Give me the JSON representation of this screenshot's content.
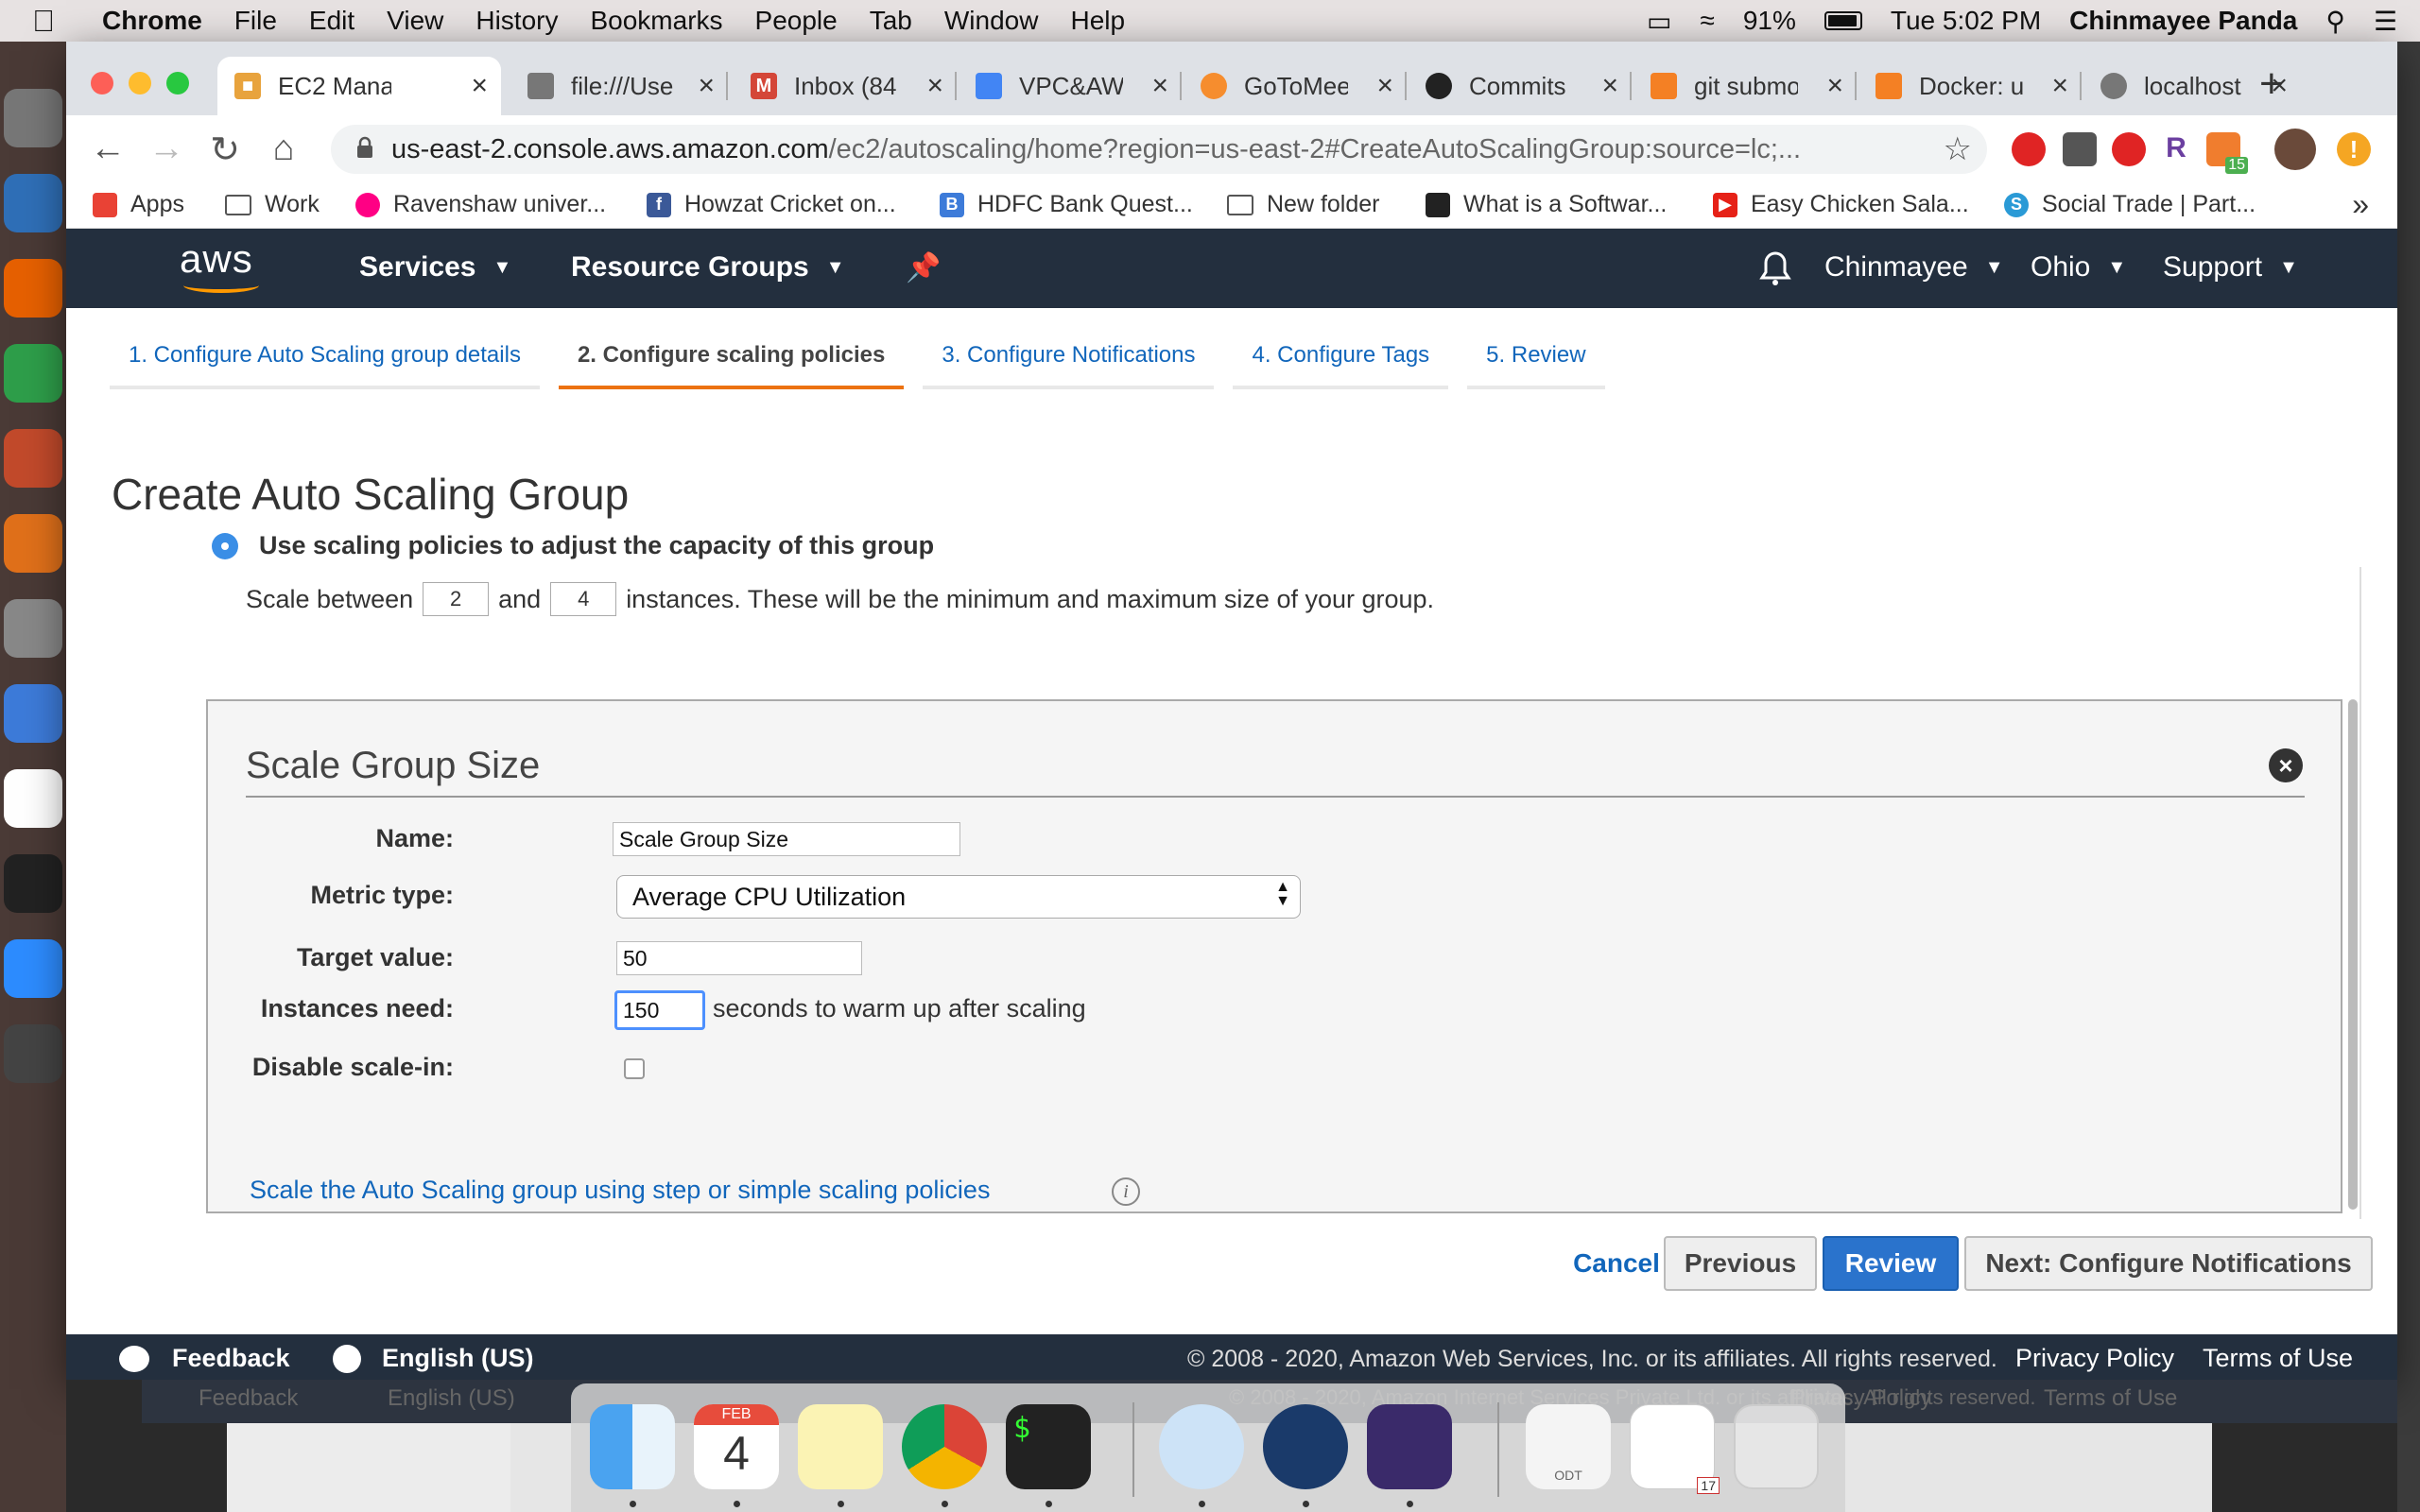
{
  "menubar": {
    "app": "Chrome",
    "items": [
      "File",
      "Edit",
      "View",
      "History",
      "Bookmarks",
      "People",
      "Tab",
      "Window",
      "Help"
    ],
    "battery": "91%",
    "clock": "Tue 5:02 PM",
    "user": "Chinmayee Panda"
  },
  "tabs": [
    {
      "title": "EC2 Mana",
      "icon": "aws-icon",
      "color": "#e8a33d"
    },
    {
      "title": "file:///Use",
      "icon": "globe-icon",
      "color": "#777777"
    },
    {
      "title": "Inbox (84",
      "icon": "gmail-icon",
      "color": "#d44638"
    },
    {
      "title": "VPC&AWS",
      "icon": "docs-icon",
      "color": "#4285f4"
    },
    {
      "title": "GoToMeet",
      "icon": "gotomeeting-icon",
      "color": "#f68d2e"
    },
    {
      "title": "Commits",
      "icon": "github-icon",
      "color": "#222222"
    },
    {
      "title": "git submo",
      "icon": "stackoverflow-icon",
      "color": "#f48024"
    },
    {
      "title": "Docker: u",
      "icon": "stackoverflow-icon",
      "color": "#f48024"
    },
    {
      "title": "localhost",
      "icon": "globe-icon",
      "color": "#777777"
    }
  ],
  "url": {
    "host": "us-east-2.console.aws.amazon.com",
    "path": "/ec2/autoscaling/home?region=us-east-2#CreateAutoScalingGroup:source=lc;..."
  },
  "bookmarks": [
    {
      "label": "Apps",
      "icon": "apps-grid-icon",
      "color": "#e94235"
    },
    {
      "label": "Work",
      "icon": "folder-icon",
      "color": ""
    },
    {
      "label": "Ravenshaw univer...",
      "icon": "flickr-icon",
      "color": "#ff0084"
    },
    {
      "label": "Howzat Cricket on...",
      "icon": "facebook-icon",
      "color": "#3b5998"
    },
    {
      "label": "HDFC Bank Quest...",
      "icon": "b-icon",
      "color": "#3d7bd9"
    },
    {
      "label": "New folder",
      "icon": "folder-icon",
      "color": ""
    },
    {
      "label": "What is a Softwar...",
      "icon": "site-icon",
      "color": "#222222"
    },
    {
      "label": "Easy Chicken Sala...",
      "icon": "youtube-icon",
      "color": "#e62117"
    },
    {
      "label": "Social Trade | Part...",
      "icon": "s-icon",
      "color": "#2a9ad6"
    }
  ],
  "aws": {
    "logo": "aws",
    "services": "Services",
    "resource_groups": "Resource Groups",
    "account": "Chinmayee",
    "region": "Ohio",
    "support": "Support"
  },
  "steps": [
    "1. Configure Auto Scaling group details",
    "2. Configure scaling policies",
    "3. Configure Notifications",
    "4. Configure Tags",
    "5. Review"
  ],
  "page_title": "Create Auto Scaling Group",
  "policy_option": "Use scaling policies to adjust the capacity of this group",
  "scale": {
    "prefix": "Scale between",
    "min": "2",
    "and": "and",
    "max": "4",
    "suffix": "instances. These will be the minimum and maximum size of your group."
  },
  "policy": {
    "heading": "Scale Group Size",
    "name_label": "Name:",
    "name_value": "Scale Group Size",
    "metric_label": "Metric type:",
    "metric_value": "Average CPU Utilization",
    "target_label": "Target value:",
    "target_value": "50",
    "warmup_label": "Instances need:",
    "warmup_value": "150",
    "warmup_suffix": "seconds to warm up after scaling",
    "disable_label": "Disable scale-in:",
    "disable_checked": false,
    "step_link": "Scale the Auto Scaling group using step or simple scaling policies"
  },
  "buttons": {
    "cancel": "Cancel",
    "previous": "Previous",
    "review": "Review",
    "next": "Next: Configure Notifications"
  },
  "footer": {
    "feedback": "Feedback",
    "language": "English (US)",
    "copyright": "© 2008 - 2020, Amazon Web Services, Inc. or its affiliates. All rights reserved.",
    "privacy": "Privacy Policy",
    "terms": "Terms of Use"
  },
  "ghost_footer": {
    "copyright": "© 2008 - 2020, Amazon Internet Services Private Ltd. or its affiliates. All rights reserved."
  },
  "dock": {
    "calendar_month": "FEB",
    "calendar_day": "4",
    "extension_badge": "15",
    "odt_label": "ODT",
    "doc_badge": "17"
  },
  "colors": {
    "aws_nav": "#232f3e",
    "aws_orange": "#ff9900",
    "link_blue": "#1166bb",
    "primary_button": "#2a73cc"
  }
}
